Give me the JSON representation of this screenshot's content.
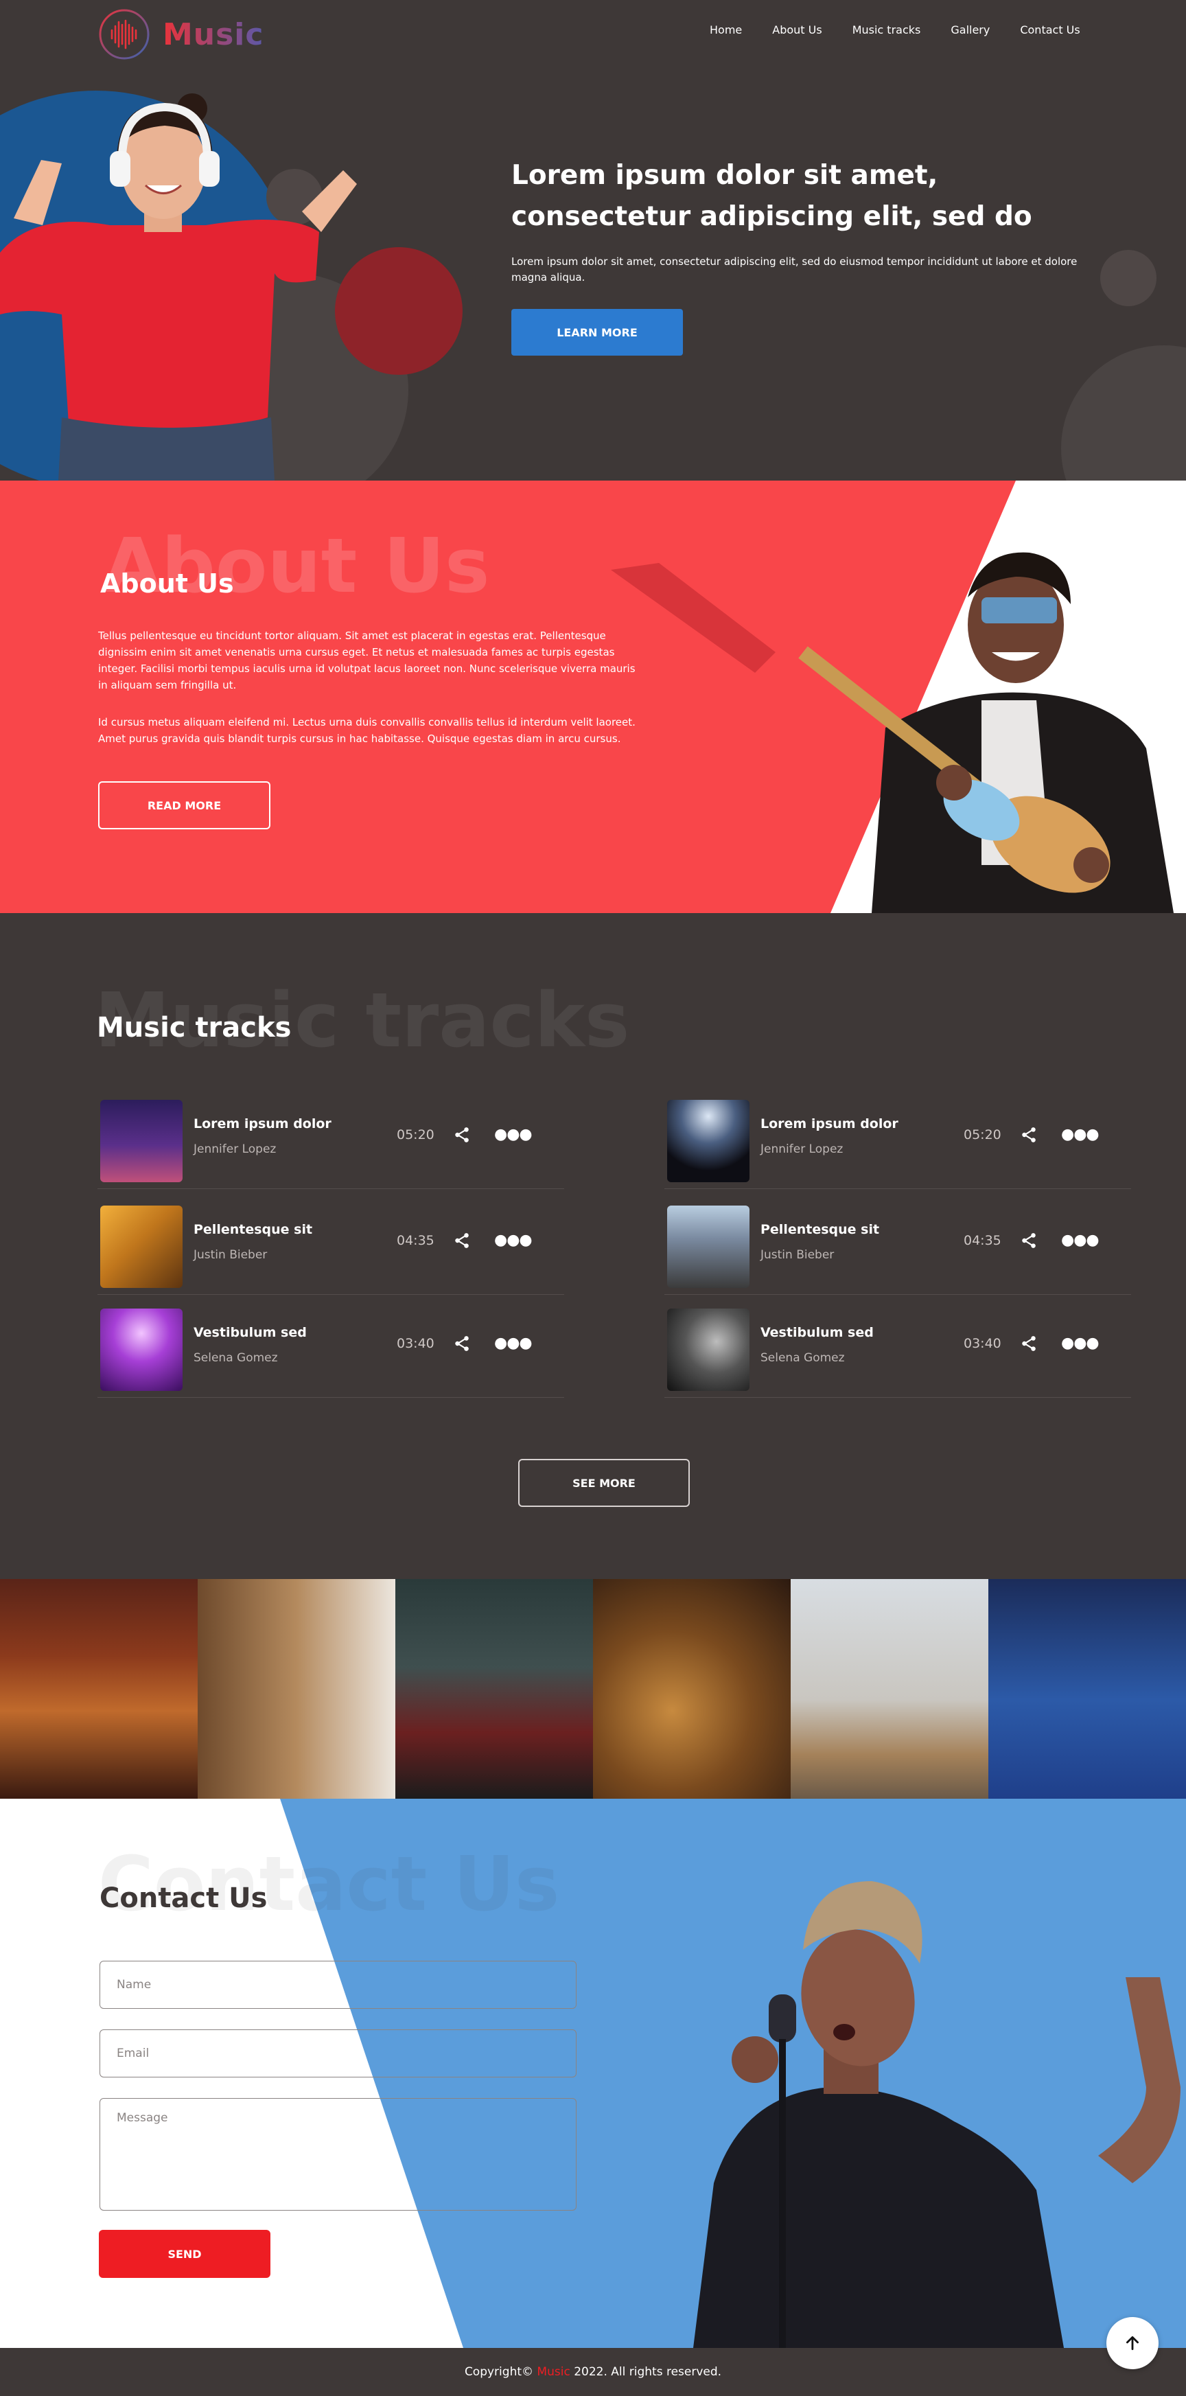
{
  "brand": {
    "name": "Music"
  },
  "nav": {
    "items": [
      "Home",
      "About Us",
      "Music tracks",
      "Gallery",
      "Contact Us"
    ]
  },
  "hero": {
    "title": "Lorem ipsum dolor sit amet, consectetur adipiscing elit, sed do",
    "text": "Lorem ipsum dolor sit amet, consectetur adipiscing elit, sed do eiusmod tempor incididunt ut labore et dolore magna aliqua.",
    "button": "LEARN MORE"
  },
  "about": {
    "bg_title": "About Us",
    "title": "About Us",
    "p1": "Tellus pellentesque eu tincidunt tortor aliquam. Sit amet est placerat in egestas erat. Pellentesque dignissim enim sit amet venenatis urna cursus eget. Et netus et malesuada fames ac turpis egestas integer. Facilisi morbi tempus iaculis urna id volutpat lacus laoreet non. Nunc scelerisque viverra mauris in aliquam sem fringilla ut.",
    "p2": "Id cursus metus aliquam eleifend mi. Lectus urna duis convallis convallis tellus id interdum velit laoreet. Amet purus gravida quis blandit turpis cursus in hac habitasse. Quisque egestas diam in arcu cursus.",
    "button": "READ MORE"
  },
  "tracks": {
    "bg_title": "Music tracks",
    "title": "Music tracks",
    "items": [
      {
        "name": "Lorem ipsum dolor",
        "artist": "Jennifer Lopez",
        "time": "05:20"
      },
      {
        "name": "Lorem ipsum dolor",
        "artist": "Jennifer Lopez",
        "time": "05:20"
      },
      {
        "name": "Pellentesque sit",
        "artist": "Justin Bieber",
        "time": "04:35"
      },
      {
        "name": "Pellentesque sit",
        "artist": "Justin Bieber",
        "time": "04:35"
      },
      {
        "name": "Vestibulum sed",
        "artist": "Selena Gomez",
        "time": "03:40"
      },
      {
        "name": "Vestibulum sed",
        "artist": "Selena Gomez",
        "time": "03:40"
      }
    ],
    "button": "SEE MORE"
  },
  "contact": {
    "bg_title": "Contact Us",
    "title": "Contact Us",
    "name_placeholder": "Name",
    "email_placeholder": "Email",
    "message_placeholder": "Message",
    "button": "SEND"
  },
  "footer": {
    "copyright_prefix": "Copyright",
    "copyright_brand": "Music",
    "copyright_suffix": "2022. All rights reserved."
  },
  "colors": {
    "dark": "#3e3837",
    "coral": "#f9464a",
    "blue": "#2c7bd0",
    "contact_blue": "#5b9ddb",
    "red": "#ee1d23"
  },
  "icons": [
    "music-logo-icon",
    "share-icon",
    "more-dots-icon",
    "arrow-up-icon"
  ]
}
